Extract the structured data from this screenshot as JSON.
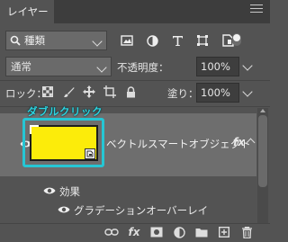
{
  "panel": {
    "tab_title": "レイヤー"
  },
  "filter": {
    "kind_label": "種類"
  },
  "blend": {
    "mode": "通常",
    "opacity_label": "不透明度：",
    "opacity_value": "100%"
  },
  "lock": {
    "label": "ロック：",
    "fill_label": "塗り：",
    "fill_value": "100%"
  },
  "annotation": {
    "text": "ダブルクリック",
    "color": "#2fd4e0"
  },
  "layer": {
    "name": "ベクトルスマートオブジェクト",
    "fx": "fx",
    "thumbnail_color": "#fcec0a",
    "effects_label": "効果",
    "effect_name": "グラデーションオーバーレイ"
  },
  "toolbar": {
    "icons": [
      "link-icon",
      "fx-icon",
      "mask-icon",
      "adjustment-icon",
      "group-folder-icon",
      "new-layer-icon",
      "trash-icon"
    ],
    "fx_label": "fx"
  }
}
